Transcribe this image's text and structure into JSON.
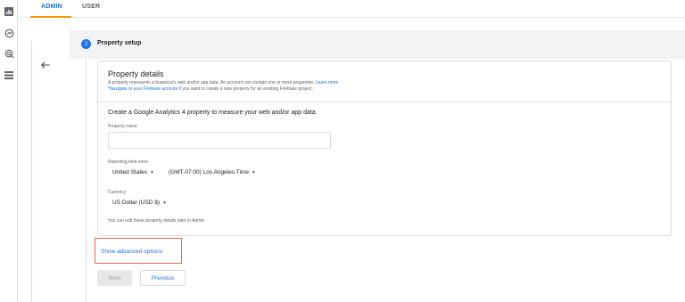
{
  "nav": {
    "icons": [
      "bar-chart-icon",
      "explore-icon",
      "advertising-icon",
      "configure-icon"
    ]
  },
  "tabs": {
    "admin": "ADMIN",
    "user": "USER"
  },
  "step": {
    "number": "2",
    "title": "Property setup"
  },
  "card": {
    "title": "Property details",
    "desc_line1": "A property represents a business's web and/or app data. An account can contain one or more properties.",
    "learn_more": "Learn more",
    "firebase_link": "*Navigate to your Firebase account",
    "desc_line2_rest": " if you want to create a new property for an existing Firebase project.",
    "create_text": "Create a Google Analytics 4 property to measure your web and/or app data.",
    "property_name_label": "Property name",
    "property_name_value": "",
    "timezone_label": "Reporting time zone",
    "country": "United States",
    "timezone": "(GMT-07:00) Los Angeles Time",
    "currency_label": "Currency",
    "currency": "US Dollar (USD $)",
    "helper": "You can edit these property details later in Admin"
  },
  "advanced": {
    "label": "Show advanced options"
  },
  "buttons": {
    "next": "Next",
    "previous": "Previous"
  },
  "colors": {
    "accent": "#1a73e8",
    "highlight_border": "#e26d4c",
    "tab_underline": "#f29900"
  }
}
